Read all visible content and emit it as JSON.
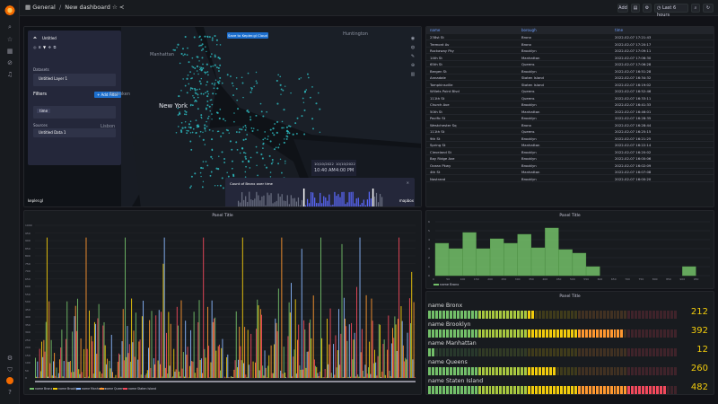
{
  "breadcrumb": {
    "section": "General",
    "title": "New dashboard",
    "separator": "/"
  },
  "topbar": {
    "time_range": "Last 6 hours",
    "add_label": "Add"
  },
  "colors": {
    "accent": "#1d6fce",
    "green": "#73bf69",
    "orange": "#ff9830",
    "yellow": "#f2cc0c"
  },
  "map": {
    "share_label": "Save to Kepler.gl Cloud",
    "city_label": "New York",
    "labels": [
      "Manhattan",
      "Huntington",
      "Hoboken",
      "Lisbon"
    ],
    "side": {
      "layer_title": "Untitled",
      "dataset_label": "Datasets",
      "dataset_name": "Untitled Layer 1",
      "filters_title": "Filters",
      "add_filter": "+ Add Filter",
      "filter_field": "time",
      "layer_item": "Untitled Data 1",
      "source_label": "Sources"
    },
    "time_start_date": "10/10/2022",
    "time_start_time": "10:40 AM",
    "time_end_date": "10/10/2022",
    "time_end_time": "4:00 PM",
    "timeline_title": "Count of Bronx over time",
    "timeline_ticks": [
      "10 AM",
      "11 AM",
      "12 PM",
      "1 PM",
      "2 PM",
      "3 PM",
      "4 PM"
    ],
    "footer_left": "kepler.gl",
    "footer_right": "mapbox"
  },
  "table": {
    "columns": [
      "name",
      "borough",
      "time"
    ],
    "rows": [
      [
        "238st St",
        "Bronx",
        "2022-02-07 17:21:43"
      ],
      [
        "Tremont Av",
        "Bronx",
        "2022-02-07 17:20:17"
      ],
      [
        "Rockaway Pky",
        "Brooklyn",
        "2022-02-07 17:09:11"
      ],
      [
        "14th St",
        "Manhattan",
        "2022-02-07 17:06:30"
      ],
      [
        "65th St",
        "Queens",
        "2022-02-07 17:06:28"
      ],
      [
        "Bergen St",
        "Brooklyn",
        "2022-02-07 16:51:28"
      ],
      [
        "Annadale",
        "Staten Island",
        "2022-02-07 16:34:32"
      ],
      [
        "Tompkinsville",
        "Staten Island",
        "2022-02-07 16:19:02"
      ],
      [
        "Willets Point Blvd",
        "Queens",
        "2022-02-07 16:52:46"
      ],
      [
        "111th St",
        "Queens",
        "2022-02-07 16:33:11"
      ],
      [
        "Church Ave",
        "Brooklyn",
        "2022-02-07 16:41:33"
      ],
      [
        "50th St",
        "Manhattan",
        "2022-02-07 16:46:01"
      ],
      [
        "Pacific St",
        "Brooklyn",
        "2022-02-07 16:28:35"
      ],
      [
        "Westchester Sq",
        "Bronx",
        "2022-02-07 16:28:44"
      ],
      [
        "111th St",
        "Queens",
        "2022-02-07 16:25:15"
      ],
      [
        "9th St",
        "Brooklyn",
        "2022-02-07 16:21:25"
      ],
      [
        "Spring St",
        "Manhattan",
        "2022-02-07 16:22:14"
      ],
      [
        "Cleveland St",
        "Brooklyn",
        "2022-02-07 16:20:02"
      ],
      [
        "Bay Ridge Ave",
        "Brooklyn",
        "2022-02-07 16:00:06"
      ],
      [
        "Ocean Pkwy",
        "Brooklyn",
        "2022-02-07 16:02:09"
      ],
      [
        "4th St",
        "Manhattan",
        "2022-02-07 16:07:08"
      ],
      [
        "Nostrand",
        "Brooklyn",
        "2022-02-07 16:00:20"
      ]
    ]
  },
  "bars_panel": {
    "title": "Panel Title",
    "y_ticks": [
      "1000",
      "950",
      "900",
      "850",
      "800",
      "750",
      "700",
      "650",
      "600",
      "550",
      "500",
      "450",
      "400",
      "350",
      "300",
      "250",
      "200",
      "150",
      "100",
      "50",
      "0"
    ],
    "legend": [
      "name Bronx",
      "name Brooklyn",
      "name Manhattan",
      "name Queens",
      "name Staten Island"
    ]
  },
  "hist_panel": {
    "title": "Panel Title",
    "legend": "name Bronx"
  },
  "chart_data": {
    "type": "bar",
    "title": "Panel Title",
    "x": [
      0,
      50,
      100,
      150,
      200,
      250,
      300,
      350,
      400,
      450,
      500,
      550,
      600,
      650,
      700,
      750,
      800,
      850,
      900,
      950
    ],
    "values": [
      3.6,
      3.0,
      4.8,
      3.0,
      4.1,
      3.6,
      4.6,
      3.1,
      5.3,
      2.9,
      2.5,
      1.0,
      0,
      0,
      0,
      0,
      0,
      0,
      1.0,
      0
    ],
    "x_ticks": [
      "0",
      "50",
      "100",
      "150",
      "200",
      "250",
      "300",
      "350",
      "400",
      "450",
      "500",
      "550",
      "600",
      "650",
      "700",
      "750",
      "800",
      "850",
      "900",
      "950"
    ],
    "y_ticks": [
      "0",
      "1",
      "2",
      "3",
      "4",
      "5",
      "6"
    ],
    "ylim": [
      0,
      6
    ],
    "xlim": [
      0,
      1000
    ],
    "grid": true,
    "legend_position": "bottom-left"
  },
  "gauge_panel": {
    "title": "Panel Title",
    "max": 500,
    "items": [
      {
        "label": "name Bronx",
        "value": "212",
        "fraction": 0.424
      },
      {
        "label": "name Brooklyn",
        "value": "392",
        "fraction": 0.784
      },
      {
        "label": "name Manhattan",
        "value": "12",
        "fraction": 0.024
      },
      {
        "label": "name Queens",
        "value": "260",
        "fraction": 0.52
      },
      {
        "label": "name Staten Island",
        "value": "482",
        "fraction": 0.964
      }
    ]
  }
}
